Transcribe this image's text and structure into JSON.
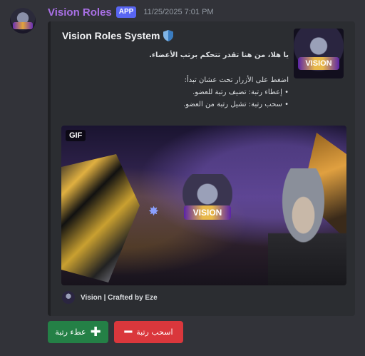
{
  "message": {
    "username": "Vision Roles",
    "badge": "APP",
    "timestamp": "11/25/2025 7:01 PM"
  },
  "embed": {
    "title": "Vision Roles System",
    "thumbnail_text": "VISION",
    "lines": [
      "يا هلا، من هنا تقدر تتحكم برتب الأعضاء.",
      "اضغط على الأزرار تحت عشان تبدأ:",
      "• إعطاء رتبة: تضيف رتبة للعضو.",
      "• سحب رتبة: تشيل رتبة من العضو."
    ],
    "media": {
      "badge": "GIF",
      "crest_text": "VISION"
    },
    "footer": "Vision | Crafted by Eze"
  },
  "buttons": {
    "give_label": "عطء رتبة",
    "take_label": "اسحب رتبة"
  },
  "colors": {
    "username": "#a970e6",
    "app_badge": "#5865f2",
    "give_button": "#248046",
    "take_button": "#da373c"
  }
}
